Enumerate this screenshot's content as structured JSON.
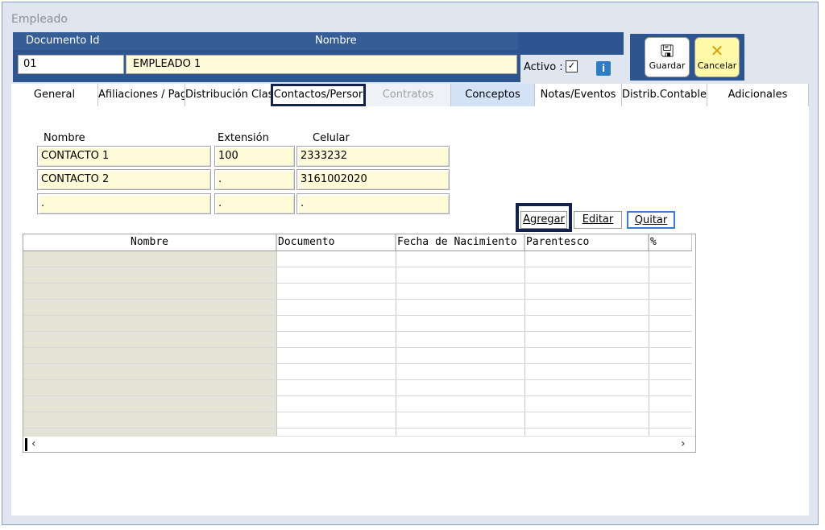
{
  "window": {
    "title": "Empleado"
  },
  "header": {
    "doc_label": "Documento Id",
    "name_label": "Nombre",
    "doc_value": "01",
    "name_value": "EMPLEADO 1",
    "activo_label": "Activo :",
    "activo_check": "✓",
    "info_icon": "i"
  },
  "actions": {
    "guardar": "Guardar",
    "cancelar": "Cancelar"
  },
  "tabs": [
    "General",
    "Afiliaciones / Pag",
    "Distribución Clas",
    "Contactos/Persor",
    "Contratos",
    "Conceptos",
    "Notas/Eventos",
    "Distrib.Contable",
    "Adicionales"
  ],
  "contacts": {
    "headers": {
      "nombre": "Nombre",
      "extension": "Extensión",
      "celular": "Celular"
    },
    "rows": [
      {
        "nombre": "CONTACTO 1",
        "extension": "100",
        "celular": "2333232"
      },
      {
        "nombre": "CONTACTO 2",
        "extension": ".",
        "celular": "3161002020"
      },
      {
        "nombre": ".",
        "extension": ".",
        "celular": "."
      }
    ]
  },
  "buttons": {
    "agregar": "Agregar",
    "editar": "Editar",
    "quitar": "Quitar"
  },
  "grid": {
    "columns": [
      "Nombre",
      "Documento",
      "Fecha de Nacimiento",
      "Parentesco",
      "%"
    ]
  }
}
